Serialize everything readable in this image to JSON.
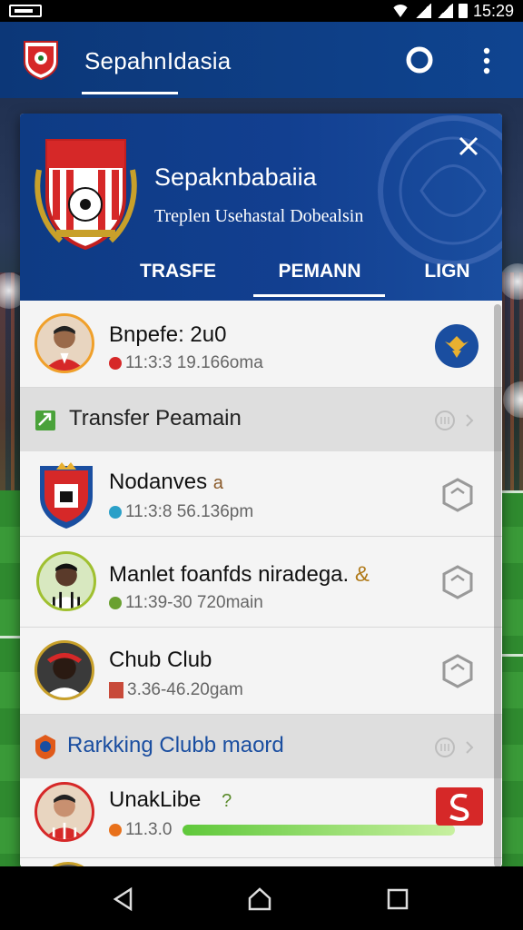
{
  "app": {
    "title": "SepahnIdasia"
  },
  "card": {
    "title": "Sepaknbabaiia",
    "subtitle": "Treplen Usehastal Dobealsin",
    "tabs": [
      {
        "label": "TRASFE"
      },
      {
        "label": "PEMANN"
      },
      {
        "label": "LIGN"
      }
    ],
    "active_tab": "PEMANN"
  },
  "list": {
    "rows": [
      {
        "title": "Bnpefe: 2u0",
        "meta": "11:3:3 19.166oma"
      },
      {
        "title": "Nodanves",
        "badge": "a",
        "meta": "11:3:8 56.136pm"
      },
      {
        "title": "Manlet foanfds niradega.",
        "badge": "&",
        "meta": "11:39-30 720main"
      },
      {
        "title": "Chub Club",
        "meta": "3.36-46.20gam"
      },
      {
        "title": "UnakLibe",
        "badge": "?",
        "meta": "11.3.0"
      }
    ],
    "sections": [
      {
        "label": "Transfer Peamain"
      },
      {
        "label": "Rarkking Clubb maord"
      }
    ]
  },
  "colors": {
    "primary": "#0f4490",
    "accent_green": "#7ed957",
    "red": "#d62828"
  }
}
